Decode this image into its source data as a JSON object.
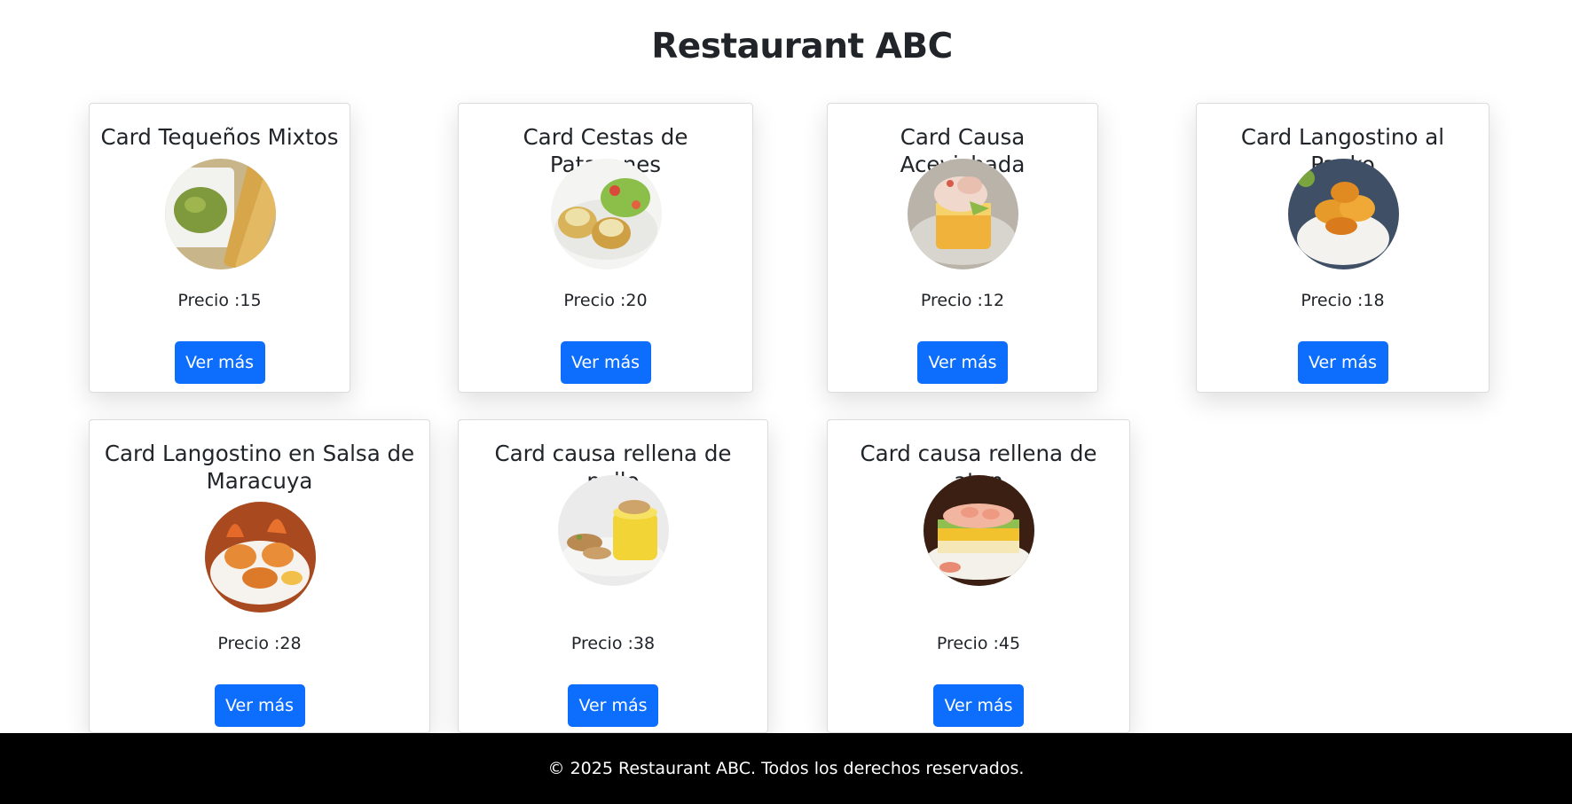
{
  "page": {
    "title": "Restaurant ABC"
  },
  "cards": [
    {
      "title": "Card Tequeños Mixtos",
      "image": "tequenos-guacamole-photo",
      "price": "Precio :15",
      "button": "Ver más"
    },
    {
      "title": "Card Cestas de Patacones",
      "image": "patacones-salad-photo",
      "price": "Precio :20",
      "button": "Ver más"
    },
    {
      "title": "Card Causa Acevichada",
      "image": "causa-acevichada-photo",
      "price": "Precio :12",
      "button": "Ver más"
    },
    {
      "title": "Card Langostino al Panko",
      "image": "langostino-panko-photo",
      "price": "Precio :18",
      "button": "Ver más"
    },
    {
      "title": "Card Langostino en Salsa de Maracuya",
      "image": "langostino-maracuya-photo",
      "price": "Precio :28",
      "button": "Ver más"
    },
    {
      "title": "Card causa rellena de pollo",
      "image": "causa-pollo-photo",
      "price": "Precio :38",
      "button": "Ver más"
    },
    {
      "title": "Card causa rellena de atun",
      "image": "causa-atun-photo",
      "price": "Precio :45",
      "button": "Ver más"
    }
  ],
  "footer": {
    "text": "© 2025 Restaurant ABC. Todos los derechos reservados."
  },
  "colors": {
    "primary_button": "#0d6efd",
    "footer_bg": "#000000"
  }
}
